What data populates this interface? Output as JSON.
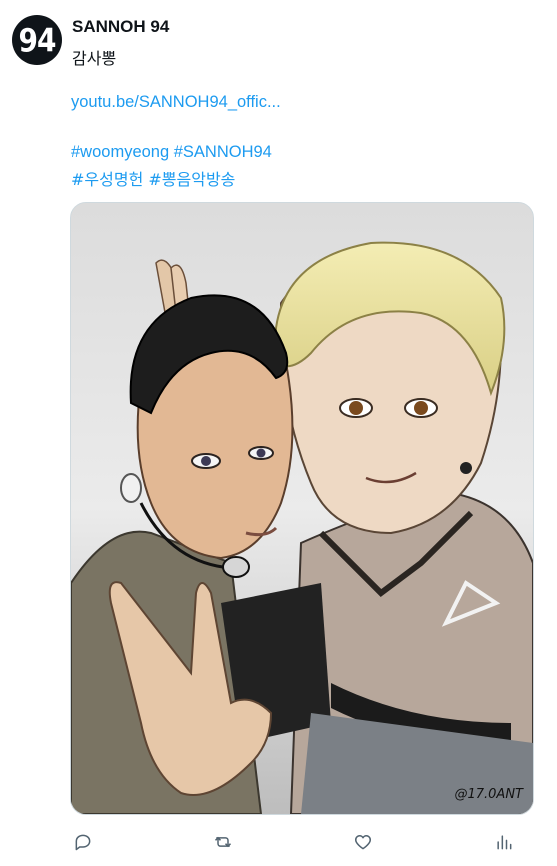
{
  "tweet": {
    "avatar_text": "94",
    "display_name": "SANNOH 94",
    "text": "감사뽕",
    "link": "youtu.be/SANNOH94_offic...",
    "hashtags_en": "#woomyeong #SANNOH94",
    "hashtags_ko": "#우성명헌 #뽕음악방송",
    "image_watermark": "@17.0ANT"
  },
  "actions": {
    "reply_icon": "reply-icon",
    "retweet_icon": "retweet-icon",
    "like_icon": "heart-icon",
    "views_icon": "analytics-icon"
  },
  "colors": {
    "link": "#1d9bf0",
    "text": "#0f1419",
    "icon": "#536471"
  }
}
